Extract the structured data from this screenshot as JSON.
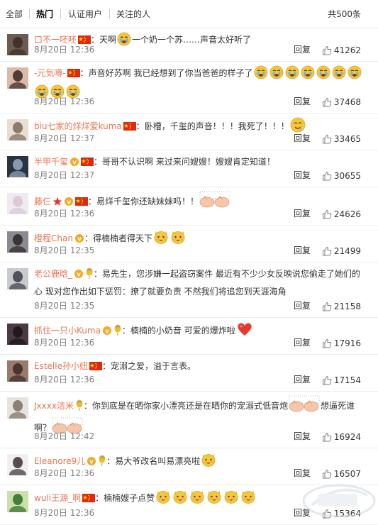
{
  "tabs": [
    {
      "label": "全部"
    },
    {
      "label": "热门"
    },
    {
      "label": "认证用户"
    },
    {
      "label": "关注的人"
    }
  ],
  "total": "共500条",
  "reply_label": "回复",
  "colors": {
    "username": "#eb7350",
    "meta": "#808080",
    "heart": "#e8372b",
    "emoji_face": "#f7c73a",
    "paw": "#f5c7a8"
  },
  "comments": [
    {
      "user": "口不一呸呸",
      "badges": [
        "flag-cn-icon"
      ],
      "text_before": "：天啊",
      "emojis": [
        "crying-face-icon"
      ],
      "text": "一个奶一个苏……声音太好听了",
      "emojis_after": [],
      "text_after": "",
      "time": "8月20日 12:36",
      "likes": "41262"
    },
    {
      "user": "-元気噂-",
      "badges": [
        "flag-cn-icon"
      ],
      "text_before": "",
      "emojis": [],
      "text": "：声音好苏啊 我已经想到了你当爸爸的样子了",
      "emojis_after": [
        "crying-face-icon",
        "crying-face-icon",
        "crying-face-icon",
        "crying-face-icon",
        "crying-face-icon",
        "crying-face-icon",
        "crying-face-icon",
        "crying-face-icon",
        "crying-face-icon",
        "crying-face-icon"
      ],
      "text_after": "",
      "time": "8月20日 12:36",
      "likes": "37468"
    },
    {
      "user": "biu七家的烊烊爱kuma",
      "badges": [
        "flag-cn-icon"
      ],
      "text_before": "",
      "emojis": [],
      "text": "：卧槽，千玺的声音！！！我死了！！！",
      "emojis_after": [
        "drooling-face-icon"
      ],
      "text_after": "",
      "time": "8月20日 12:37",
      "likes": "33465"
    },
    {
      "user": "半甲千玺",
      "badges": [
        "vip-icon",
        "flag-cn-icon"
      ],
      "text_before": "",
      "emojis": [],
      "text": "：哥哥不认识啊 来过来问嫂嫂！嫂嫂肯定知道！",
      "emojis_after": [],
      "text_after": "",
      "time": "8月20日 12:37",
      "likes": "30655"
    },
    {
      "user": "藤仨",
      "badges": [
        "star-icon",
        "vip-icon",
        "flag-cn-icon"
      ],
      "text_before": "",
      "emojis": [],
      "text": "：易烊千玺你还缺妹妹吗！！",
      "emojis_after": [
        "paw-icon"
      ],
      "text_after": "",
      "time": "8月20日 12:36",
      "likes": "24626"
    },
    {
      "user": "橙程Chan",
      "badges": [
        "vip-icon"
      ],
      "text_before": "",
      "emojis": [],
      "text": "：得楠楠者得天下",
      "emojis_after": [
        "cat-face-icon",
        "cat-face-icon"
      ],
      "text_after": "",
      "time": "8月20日 12:35",
      "likes": "21499"
    },
    {
      "user": "老公鹿晗_",
      "badges": [
        "vip-icon",
        "balloon-icon"
      ],
      "text_before": "",
      "emojis": [],
      "text": "：易先生，您涉嫌一起盗窃案件 最近有不少少女反映说您偷走了她们的心 现对您作出如下惩罚：撩了就要负责 不然我们将追您到天涯海角",
      "emojis_after": [],
      "text_after": "",
      "time": "8月20日 12:35",
      "likes": "21158"
    },
    {
      "user": "抓住一只小Kuma",
      "badges": [
        "vip-icon",
        "balloon-icon"
      ],
      "text_before": "",
      "emojis": [],
      "text": "：楠楠的小奶音 可爱的爆炸啦",
      "emojis_after": [
        "heart-icon"
      ],
      "text_after": "",
      "time": "8月20日 12:36",
      "likes": "17916"
    },
    {
      "user": "Estelle孙小妞",
      "badges": [
        "flag-cn-icon"
      ],
      "text_before": "",
      "emojis": [],
      "text": "：宠溺之爱，溢于言表。",
      "emojis_after": [],
      "text_after": "",
      "time": "8月20日 12:36",
      "likes": "17154"
    },
    {
      "user": "Jxxxx洁米",
      "badges": [
        "balloon-icon"
      ],
      "text_before": "",
      "emojis": [],
      "text": "：你到底是在晒你家小漂亮还是在晒你的宠溺式低音炮",
      "emojis_after": [
        "paw-icon"
      ],
      "text_after": "想逼死谁啊？",
      "emojis_end": [
        "paw-icon"
      ],
      "time": "8月20日 12:42",
      "likes": "16924"
    },
    {
      "user": "Eleanore9儿",
      "badges": [
        "vip-icon",
        "balloon-icon"
      ],
      "text_before": "",
      "emojis": [],
      "text": "：易大爷改名叫易漂亮啦",
      "emojis_after": [
        "cat-face-icon"
      ],
      "text_after": "",
      "time": "8月20日 12:36",
      "likes": "16507"
    },
    {
      "user": "wuli王源_啊",
      "badges": [
        "flag-cn-icon"
      ],
      "text_before": "",
      "emojis": [],
      "text": "：楠楠嫂子点赞",
      "emojis_after": [
        "cat-face-icon",
        "cat-face-icon",
        "cat-face-icon",
        "cat-face-icon",
        "cat-face-icon",
        "cat-face-icon"
      ],
      "text_after": "",
      "time": "8月20日 12:36",
      "likes": "15364"
    }
  ]
}
